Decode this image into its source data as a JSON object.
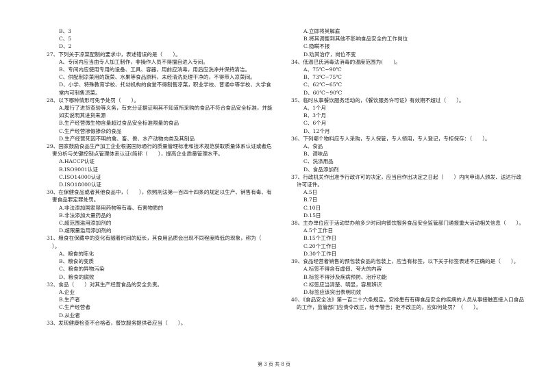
{
  "left_column": {
    "carryover_options": [
      "B、3",
      "C、5",
      "D、2"
    ],
    "questions": [
      {
        "stem": "27、下列关于凉菜配制的要求中，表述错误的是（　　）。",
        "options": [
          "A、专间内应当由专人加工制作，非操作人员不得擅自进入专间。",
          "B、专间内应使用专用的设备、工具、容器，用前应消毒，用后应洗净并保持清洁。",
          "C、供配制凉菜用的蔬菜、水果等食品原料，未经清洗处理干净的，不得带入凉菜间。",
          "D、小学、特殊教育学校、托幼机构的食堂不得制售凉菜，职业学校、普通中等学校、大学食堂内可制售凉菜。"
        ]
      },
      {
        "stem": "28、以下哪种情形可免予处罚（　　）。",
        "options": [
          "A.履行了进货查验等义务，有充分证据证明其不知道所采购的食品不符合食品安全标准，并能如实说明其进货来源",
          "B.生产经营微生物含量超过食品安全标准限量的食品",
          "C.生产经营掺假掺杂的食品",
          "D.生产经营死因不明的禽、畜、兽、水产动物肉类及其制品"
        ]
      },
      {
        "stem": "29、国家鼓励食品生产加工企业根据国际通行的质量管理标准和技术规范获取质量体系认证或者危害分析与关键控制点管理体系认证(简称（　　），提高企业质量管理水平。",
        "options": [
          "A.HACCP认证",
          "B.ISO9001认证",
          "C.ISO14000认证",
          "D.ISO18000认证"
        ]
      },
      {
        "stem": "30、在保健食品或者其他食品中，（　　），依照刑法第一百四十四条的规定以生产、销售有毒、有害食品罪定罪处罚。",
        "options": [
          "A.非法添加国家禁用药物等有毒、有害物质的",
          "B.非法添加大量药品的",
          "C.超范围滥用添加剂的",
          "D.超限量滥用添加剂的"
        ]
      },
      {
        "stem": "31、粮食在保藏中的变化有随着时间的延长，其食用品质会出现不同程度降低的现象，称为（　　）。",
        "options": [
          "A、粮食的陈化",
          "B、粮食的变质",
          "C、粮食的异物污染",
          "D、粮食的腐败"
        ]
      },
      {
        "stem": "32、食品（　　）对其生产经营食品的安全负责。",
        "options": [
          "A.企业",
          "B.生产者",
          "C.生产经营者",
          "D.从业者"
        ]
      },
      {
        "stem": "33、发现健康检查不合格者，餐饮服务提供者应当（　　）。",
        "options": []
      }
    ]
  },
  "right_column": {
    "carryover_options": [
      "A.立即将其解雇",
      "B.将其调整到其他不影响食品安全的工作岗位",
      "C.隐瞒不报",
      "D.劝其治疗，岗位不变"
    ],
    "questions": [
      {
        "stem": "34、低温巴氏消毒法消毒的温度范围为(　　)。",
        "options": [
          "A、75℃~90℃",
          "B、73℃~75℃",
          "C、62℃~65℃",
          "D、60℃~90℃"
        ]
      },
      {
        "stem": "35、临时从事餐饮服务活动的，《餐饮服务许可证》有效期不超过（　　）。",
        "options": [
          "A、1个月",
          "B、3个月",
          "C、6个月",
          "D、12个月"
        ]
      },
      {
        "stem": "36、下列哪个物料应专人采购，专人保管，专人领用，专人登记，专柜保存：（　　）。",
        "options": [
          "A、食品",
          "B、调味品",
          "C、洗涤用品",
          "D、食品添加剂"
        ]
      },
      {
        "stem": "37、行政机关作出准予行政许可的决定，应当自作出决定之日起（　　）内向申请人颁发、送达行政许可证件。",
        "options": [
          "A.5日",
          "B.7日",
          "C.10日",
          "D.15日"
        ]
      },
      {
        "stem": "38、主办单位应于活动举办前多少时间向餐饮服务食品安全监管部门通报重大活动相关信息（　　）。",
        "options": [
          "A.5个工作日",
          "B.15个工作日",
          "C.20个工作日",
          "D.30个工作日"
        ]
      },
      {
        "stem": "39、食品经营者销售的预包装食品的包装上，应当有标签，以下关于标签表述不正确的是（　　）。",
        "options": [
          "A.标签不得含有虚假、夸大的内容",
          "B.标签不得涉及疾病预防、治疗功能",
          "C.标签应当清楚、明显，容易辨识",
          "D.标签应该突出表明功效"
        ]
      },
      {
        "stem": "40、《食品安全法》第一百二十六条规定，安排患有有碍食品安全的疾病的人员从事接触直接入口食品的工作，监管部门应责令改正，给予警告；拒不改正的，应如何处罚？（　　）。",
        "options": []
      }
    ]
  },
  "footer": {
    "page_label": "第 3 页 共 8 页"
  }
}
